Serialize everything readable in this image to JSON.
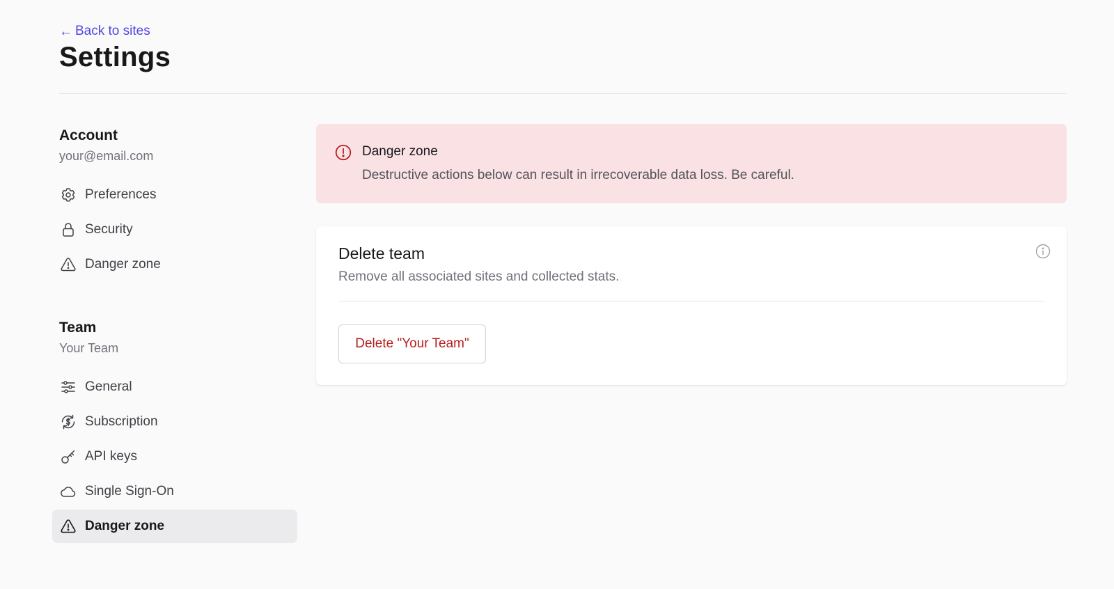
{
  "header": {
    "back_label": "Back to sites",
    "title": "Settings"
  },
  "sidebar": {
    "account": {
      "title": "Account",
      "email": "your@email.com",
      "items": [
        {
          "label": "Preferences",
          "icon": "gear-icon"
        },
        {
          "label": "Security",
          "icon": "lock-icon"
        },
        {
          "label": "Danger zone",
          "icon": "warning-icon"
        }
      ]
    },
    "team": {
      "title": "Team",
      "name": "Your Team",
      "items": [
        {
          "label": "General",
          "icon": "sliders-icon"
        },
        {
          "label": "Subscription",
          "icon": "subscription-dollar-icon"
        },
        {
          "label": "API keys",
          "icon": "key-icon"
        },
        {
          "label": "Single Sign-On",
          "icon": "cloud-icon"
        },
        {
          "label": "Danger zone",
          "icon": "warning-icon",
          "active": true
        }
      ]
    }
  },
  "alert": {
    "title": "Danger zone",
    "text": "Destructive actions below can result in irrecoverable data loss. Be careful.",
    "icon": "alert-circle-icon"
  },
  "card": {
    "title": "Delete team",
    "description": "Remove all associated sites and collected stats.",
    "button_label": "Delete \"Your Team\"",
    "info_icon": "info-icon"
  },
  "colors": {
    "accent": "#4f46e5",
    "danger_text": "#b91c1c",
    "alert_bg": "#f9e1e4",
    "active_nav_bg": "#ebebed",
    "page_bg": "#fafafa"
  }
}
